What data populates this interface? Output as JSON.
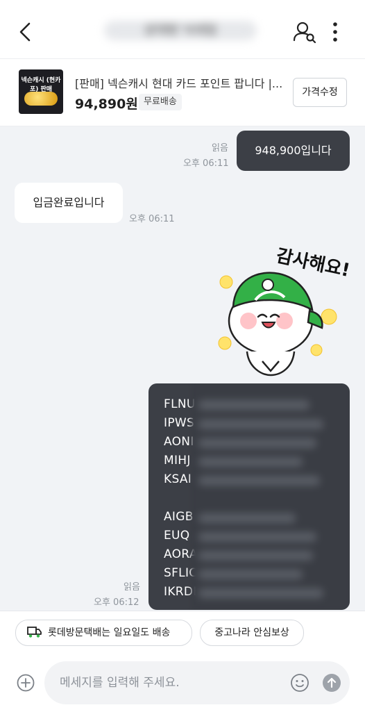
{
  "header": {
    "title": "상대방 닉네임"
  },
  "product": {
    "thumb_title": "넥슨캐시 (현카포) 판매",
    "title": "[판매] 넥슨캐시 현대 카드 포인트 팝니다 |...",
    "price": "94,890원",
    "shipping": "무료배송",
    "edit_price": "가격수정"
  },
  "messages": {
    "m1": {
      "read": "읽음",
      "time": "오후 06:11",
      "text": "948,900입니다"
    },
    "m2": {
      "time": "오후 06:11",
      "text": "입금완료입니다"
    },
    "sticker": {
      "text": "감사해요!"
    },
    "m3": {
      "read": "읽음",
      "time": "오후 06:12",
      "codes": [
        "FLNU",
        "IPWS",
        "AONI",
        "MIHJ",
        "KSAI",
        "",
        "AIGB",
        "EUQ",
        "AORA",
        "SFLIC",
        "IKRDE"
      ]
    }
  },
  "bottom": {
    "chip_delivery": "롯데방문택배는 일요일도 배송",
    "chip_safe": "중고나라 안심보상",
    "placeholder": "메세지를 입력해 주세요."
  },
  "colors": {
    "accent": "#36b34a",
    "bubble_out": "#3c3f46",
    "chat_bg": "#f1f3f6"
  }
}
